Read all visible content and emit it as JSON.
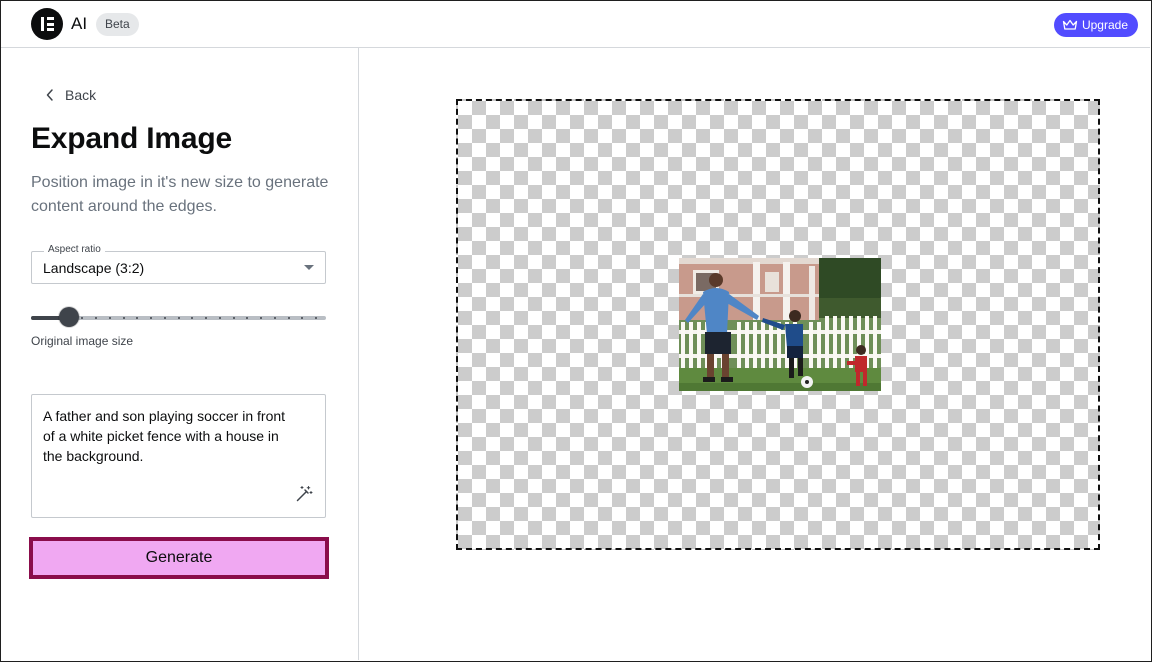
{
  "header": {
    "app_name": "AI",
    "badge": "Beta",
    "upgrade_label": "Upgrade",
    "upgrade_color": "#524cff"
  },
  "sidebar": {
    "back_label": "Back",
    "title": "Expand Image",
    "subtitle": "Position image in it's new size to generate content around the edges.",
    "aspect_ratio": {
      "label": "Aspect ratio",
      "value": "Landscape (3:2)"
    },
    "size_slider": {
      "caption": "Original image size",
      "value_fraction": 0.1,
      "steps": 20
    },
    "prompt": {
      "value": "A father and son playing soccer in front of a white picket fence with a house in the background.",
      "enhance_icon": "magic-wand-icon"
    },
    "generate_label": "Generate",
    "generate_color": "#f0a8f2",
    "generate_border_color": "#8a0d4b"
  },
  "canvas": {
    "background": "transparency-checkerboard",
    "image_description_icon": "photo-father-son-soccer"
  },
  "icons": {
    "logo": "elementor-logo-icon",
    "back": "chevron-left-icon",
    "upgrade": "crown-icon",
    "dropdown": "caret-down-icon"
  }
}
